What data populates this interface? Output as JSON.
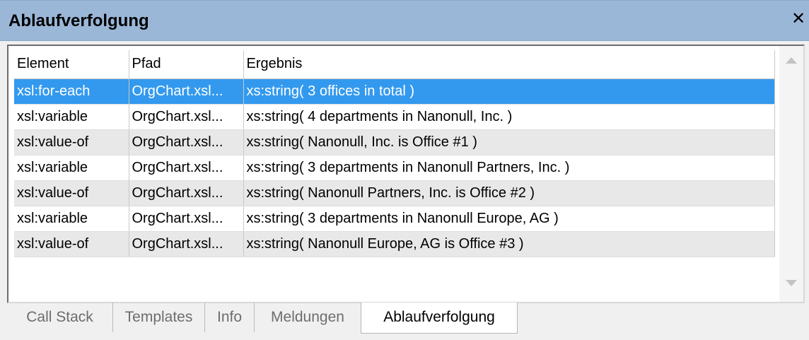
{
  "panel": {
    "title": "Ablaufverfolgung",
    "close_glyph": "✕"
  },
  "table": {
    "columns": [
      "Element",
      "Pfad",
      "Ergebnis"
    ],
    "rows": [
      {
        "element": "xsl:for-each",
        "pfad": "OrgChart.xsl...",
        "ergebnis": "xs:string( 3 offices in total )",
        "selected": true
      },
      {
        "element": "xsl:variable",
        "pfad": "OrgChart.xsl...",
        "ergebnis": "xs:string( 4 departments in Nanonull, Inc. )"
      },
      {
        "element": "xsl:value-of",
        "pfad": "OrgChart.xsl...",
        "ergebnis": "xs:string( Nanonull, Inc. is Office #1 )"
      },
      {
        "element": "xsl:variable",
        "pfad": "OrgChart.xsl...",
        "ergebnis": "xs:string( 3 departments in Nanonull Partners, Inc. )"
      },
      {
        "element": "xsl:value-of",
        "pfad": "OrgChart.xsl...",
        "ergebnis": "xs:string( Nanonull Partners, Inc. is Office #2 )"
      },
      {
        "element": "xsl:variable",
        "pfad": "OrgChart.xsl...",
        "ergebnis": "xs:string( 3 departments in Nanonull Europe, AG )"
      },
      {
        "element": "xsl:value-of",
        "pfad": "OrgChart.xsl...",
        "ergebnis": "xs:string( Nanonull Europe, AG is Office #3 )"
      }
    ]
  },
  "tabs": [
    {
      "label": "Call Stack"
    },
    {
      "label": "Templates"
    },
    {
      "label": "Info"
    },
    {
      "label": "Meldungen"
    },
    {
      "label": "Ablaufverfolgung",
      "active": true
    }
  ],
  "colors": {
    "titlebar": "#9bb7d8",
    "selection": "#3399ee",
    "alt_row": "#e8e8e8"
  }
}
